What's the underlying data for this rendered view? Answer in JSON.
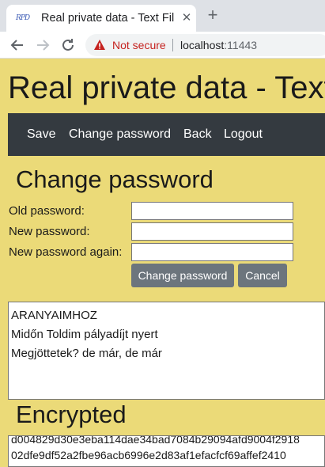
{
  "browser": {
    "tab_favicon": "RPD",
    "tab_title": "Real private data - Text Fil",
    "security_label": "Not secure",
    "url_host": "localhost",
    "url_port": ":11443"
  },
  "page": {
    "title": "Real private data - Text",
    "nav": {
      "save": "Save",
      "change_password": "Change password",
      "back": "Back",
      "logout": "Logout"
    }
  },
  "change_password": {
    "heading": "Change password",
    "old_label": "Old password:",
    "new_label": "New password:",
    "new_again_label": "New password again:",
    "submit_label": "Change password",
    "cancel_label": "Cancel"
  },
  "editor": {
    "lines": [
      "ARANYAIMHOZ",
      "",
      "Midőn Toldim pályadíjt nyert",
      "",
      "Megjöttetek? de már, de már"
    ]
  },
  "encrypted": {
    "heading": "Encrypted",
    "line1": "d004829d30e3eba114dae34bad7084b29094afd9004f2918",
    "line2": "02dfe9df52a2fbe96acb6996e2d83af1efacfcf69affef2410"
  },
  "colors": {
    "page_bg": "#ebda78",
    "navbar_bg": "#343a40",
    "button_bg": "#6c757d",
    "warning_red": "#c5221f"
  }
}
